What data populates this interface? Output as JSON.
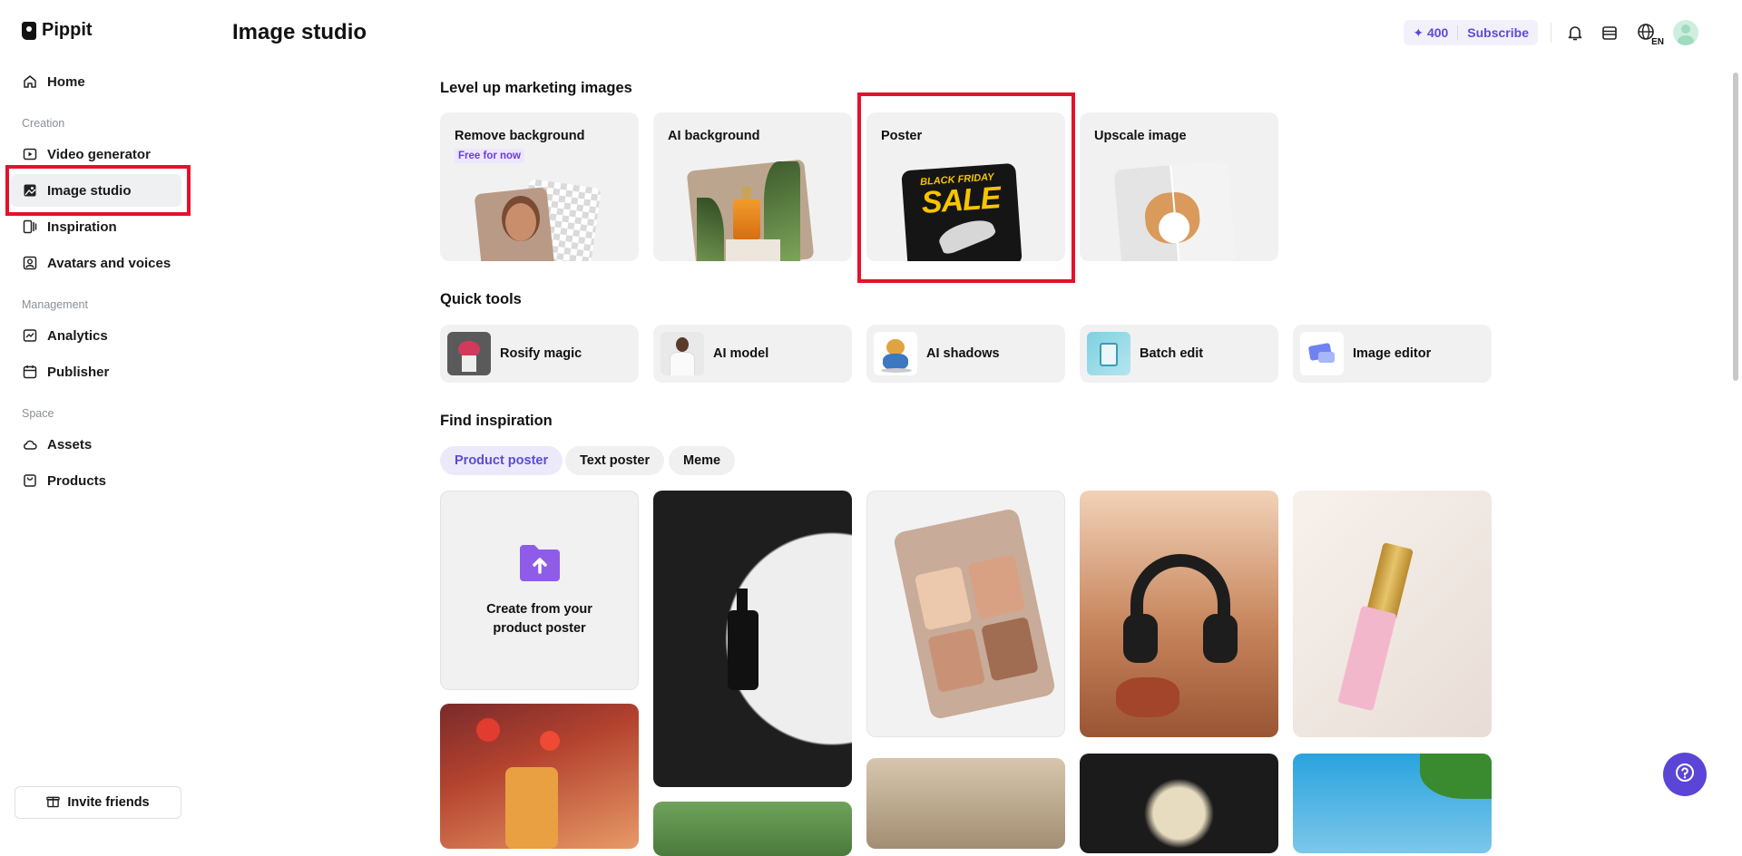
{
  "app": {
    "name": "Pippit"
  },
  "sidebar": {
    "home": "Home",
    "section_creation": "Creation",
    "video_generator": "Video generator",
    "image_studio": "Image studio",
    "inspiration": "Inspiration",
    "avatars_voices": "Avatars and voices",
    "section_management": "Management",
    "analytics": "Analytics",
    "publisher": "Publisher",
    "section_space": "Space",
    "assets": "Assets",
    "products": "Products",
    "invite": "Invite friends"
  },
  "header": {
    "title": "Image studio",
    "credits": "400",
    "subscribe": "Subscribe",
    "language": "EN"
  },
  "marketing": {
    "heading": "Level up marketing images",
    "cards": [
      {
        "title": "Remove background",
        "badge": "Free for now"
      },
      {
        "title": "AI background"
      },
      {
        "title": "Poster",
        "poster_top": "BLACK FRIDAY",
        "poster_main": "SALE"
      },
      {
        "title": "Upscale image"
      }
    ]
  },
  "quick_tools": {
    "heading": "Quick tools",
    "items": [
      "Rosify magic",
      "AI model",
      "AI shadows",
      "Batch edit",
      "Image editor"
    ]
  },
  "inspiration": {
    "heading": "Find inspiration",
    "tabs": [
      "Product poster",
      "Text poster",
      "Meme"
    ],
    "active_tab": "Product poster",
    "create_text": "Create from your product poster"
  },
  "colors": {
    "accent": "#5b4bd7",
    "highlight": "#e5112b"
  }
}
